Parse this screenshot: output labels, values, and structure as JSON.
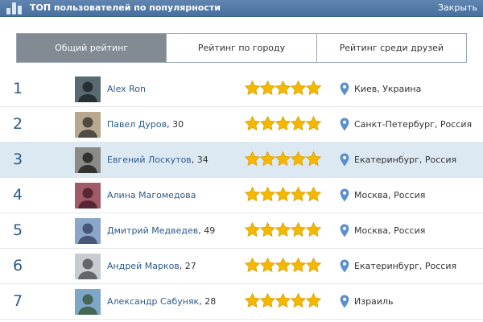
{
  "header": {
    "title": "ТОП пользователей по популярности",
    "close_label": "Закрыть"
  },
  "tabs": [
    {
      "label": "Общий рейтинг",
      "active": true
    },
    {
      "label": "Рейтинг по городу",
      "active": false
    },
    {
      "label": "Рейтинг среди друзей",
      "active": false
    }
  ],
  "colors": {
    "header": "#4f77a4",
    "link": "#2b5a8a",
    "star": "#f5b800",
    "pin": "#5b8fd0",
    "highlight_row": "#dde9f2",
    "active_tab": "#828a94"
  },
  "rating_max": 5,
  "users": [
    {
      "rank": "1",
      "name": "Alex Ron",
      "age": "",
      "stars": 5,
      "location": "Киев, Украина",
      "highlighted": false,
      "avatar_colors": [
        "#5a6a72",
        "#1d2428"
      ]
    },
    {
      "rank": "2",
      "name": "Павел Дуров",
      "age": ", 30",
      "stars": 5,
      "location": "Санкт-Петербург, Россия",
      "highlighted": false,
      "avatar_colors": [
        "#b8a890",
        "#3e3a36"
      ]
    },
    {
      "rank": "3",
      "name": "Евгений Лоскутов",
      "age": ", 34",
      "stars": 5,
      "location": "Екатеринбург, Россия",
      "highlighted": true,
      "avatar_colors": [
        "#8a8a86",
        "#222"
      ]
    },
    {
      "rank": "4",
      "name": "Алина Магомедова",
      "age": "",
      "stars": 5,
      "location": "Москва, Россия",
      "highlighted": false,
      "avatar_colors": [
        "#a05a68",
        "#4a1e2a"
      ]
    },
    {
      "rank": "5",
      "name": "Дмитрий Медведев",
      "age": ", 49",
      "stars": 5,
      "location": "Москва, Россия",
      "highlighted": false,
      "avatar_colors": [
        "#8aa6c8",
        "#3a4a66"
      ]
    },
    {
      "rank": "6",
      "name": "Андрей Марков",
      "age": ", 27",
      "stars": 5,
      "location": "Екатеринбург, Россия",
      "highlighted": false,
      "avatar_colors": [
        "#c8ccd0",
        "#505458"
      ]
    },
    {
      "rank": "7",
      "name": "Александр Сабуняк",
      "age": ", 28",
      "stars": 5,
      "location": "Израиль",
      "highlighted": false,
      "avatar_colors": [
        "#7ea6c8",
        "#3a5a40"
      ]
    }
  ]
}
